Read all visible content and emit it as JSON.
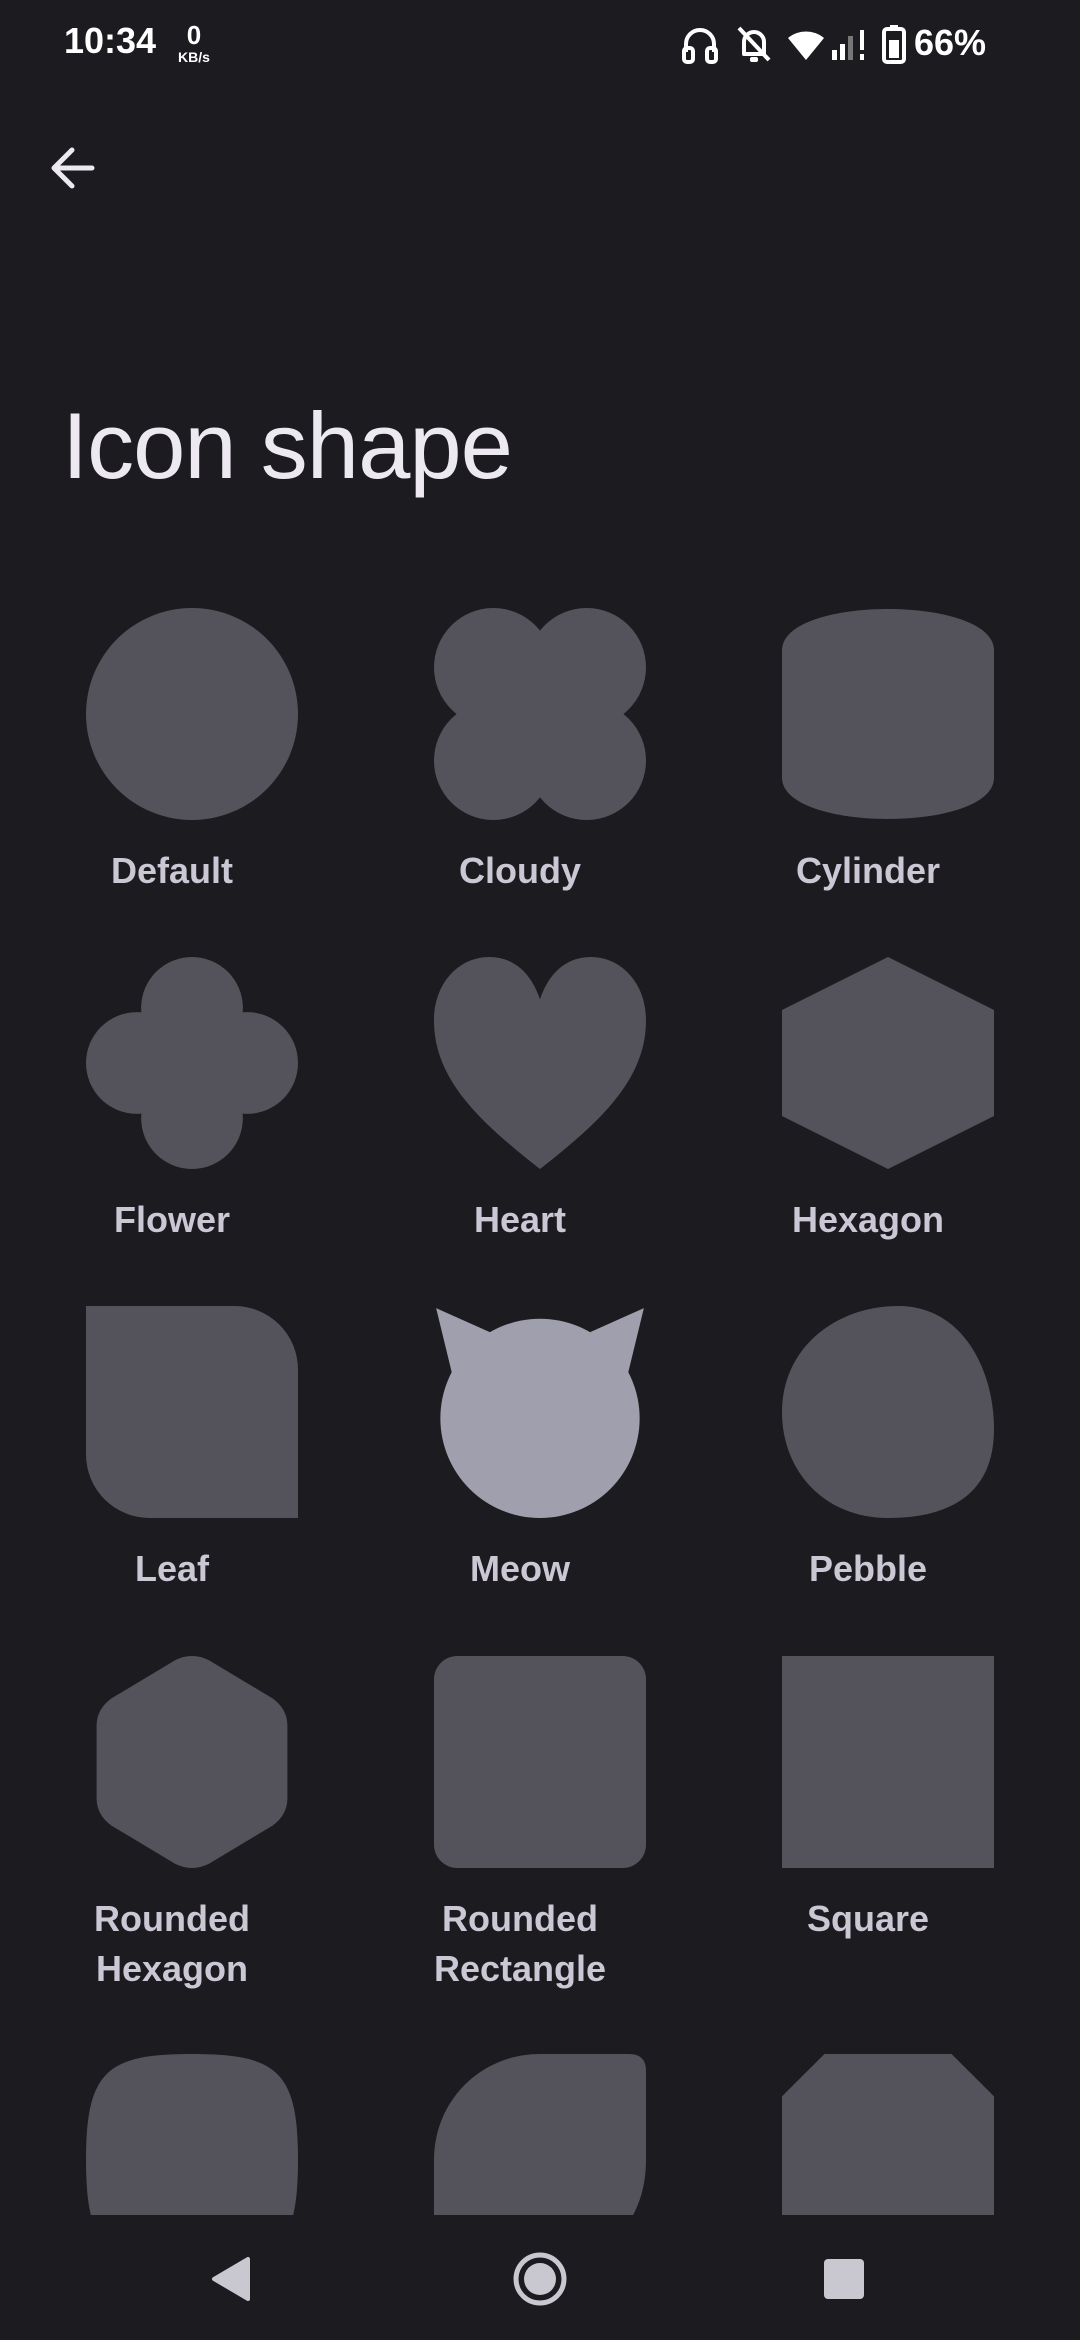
{
  "status_bar": {
    "time": "10:34",
    "net_speed_value": "0",
    "net_speed_unit": "KB/s",
    "battery_percent": "66%",
    "icons": [
      "headphones-icon",
      "notifications-off-icon",
      "wifi-icon",
      "cell-signal-icon",
      "battery-icon"
    ]
  },
  "header": {
    "back_icon": "arrow-back-icon",
    "title": "Icon shape"
  },
  "shapes": [
    {
      "label": "Default",
      "shape": "circle",
      "selected": false
    },
    {
      "label": "Cloudy",
      "shape": "cloudy",
      "selected": false
    },
    {
      "label": "Cylinder",
      "shape": "cylinder",
      "selected": false
    },
    {
      "label": "Flower",
      "shape": "flower",
      "selected": false
    },
    {
      "label": "Heart",
      "shape": "heart",
      "selected": false
    },
    {
      "label": "Hexagon",
      "shape": "hexagon",
      "selected": false
    },
    {
      "label": "Leaf",
      "shape": "leaf",
      "selected": false
    },
    {
      "label": "Meow",
      "shape": "meow",
      "selected": true
    },
    {
      "label": "Pebble",
      "shape": "pebble",
      "selected": false
    },
    {
      "label": "Rounded Hexagon",
      "shape": "rounded-hexagon",
      "selected": false
    },
    {
      "label": "Rounded Rectangle",
      "shape": "rounded-rectangle",
      "selected": false
    },
    {
      "label": "Square",
      "shape": "square",
      "selected": false
    },
    {
      "label": "",
      "shape": "squircle",
      "selected": false
    },
    {
      "label": "",
      "shape": "tapered-rect",
      "selected": false
    },
    {
      "label": "",
      "shape": "octagon",
      "selected": false
    }
  ],
  "colors": {
    "background": "#1c1b20",
    "shape_default": "#54535c",
    "shape_selected": "#a09fad",
    "label": "#cbc7d4"
  },
  "nav_bar": {
    "back_icon": "nav-back-icon",
    "home_icon": "nav-home-icon",
    "recents_icon": "nav-recents-icon"
  }
}
